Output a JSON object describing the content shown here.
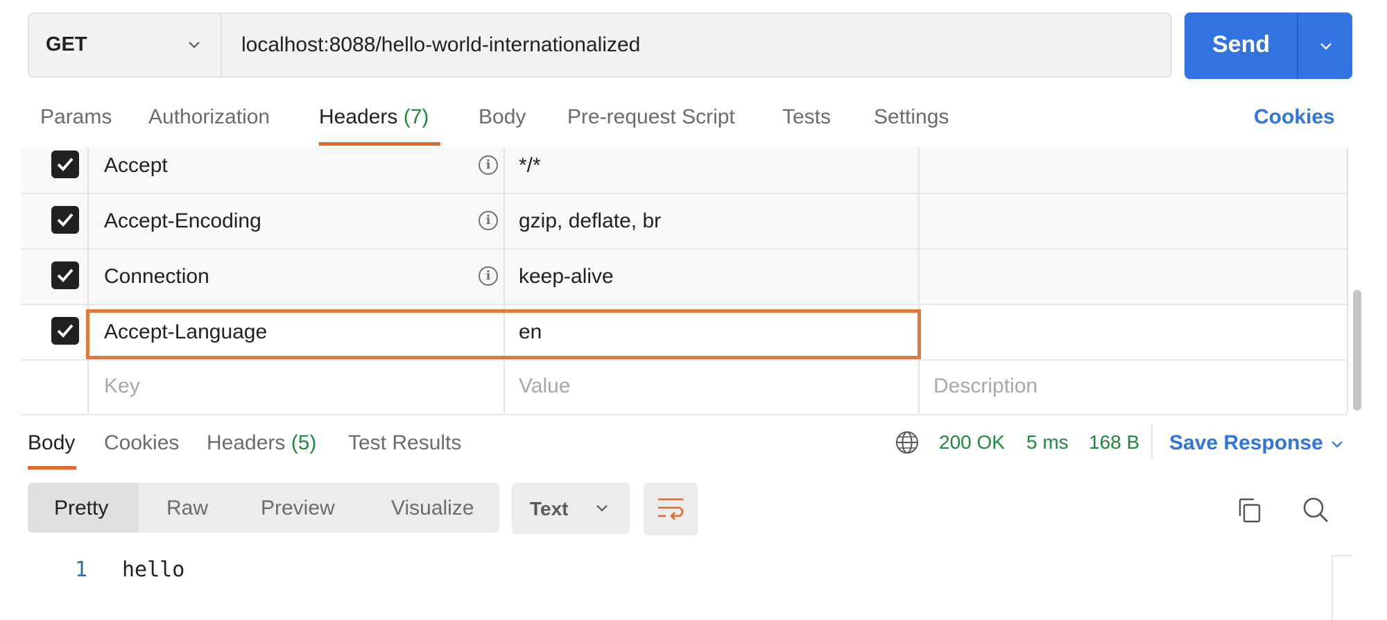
{
  "request": {
    "method": "GET",
    "url": "localhost:8088/hello-world-internationalized",
    "send_label": "Send"
  },
  "request_tabs": {
    "params": "Params",
    "authorization": "Authorization",
    "headers": "Headers",
    "headers_count": "(7)",
    "body": "Body",
    "pre_request": "Pre-request Script",
    "tests": "Tests",
    "settings": "Settings",
    "cookies": "Cookies",
    "active": "Headers"
  },
  "headers_table": {
    "rows": [
      {
        "enabled": true,
        "key": "Accept",
        "value": "*/*",
        "auto": true
      },
      {
        "enabled": true,
        "key": "Accept-Encoding",
        "value": "gzip, deflate, br",
        "auto": true
      },
      {
        "enabled": true,
        "key": "Connection",
        "value": "keep-alive",
        "auto": true
      },
      {
        "enabled": true,
        "key": "Accept-Language",
        "value": "en",
        "auto": false,
        "highlighted": true
      }
    ],
    "placeholders": {
      "key": "Key",
      "value": "Value",
      "description": "Description"
    }
  },
  "response_tabs": {
    "body": "Body",
    "cookies": "Cookies",
    "headers": "Headers",
    "headers_count": "(5)",
    "test_results": "Test Results",
    "active": "Body"
  },
  "response_status": {
    "status": "200 OK",
    "time": "5 ms",
    "size": "168 B",
    "save_label": "Save Response"
  },
  "response_view": {
    "modes": [
      "Pretty",
      "Raw",
      "Preview",
      "Visualize"
    ],
    "active_mode": "Pretty",
    "format": "Text"
  },
  "response_body": {
    "lines": [
      {
        "number": "1",
        "text": "hello"
      }
    ]
  },
  "colors": {
    "accent_blue": "#2f74e0",
    "accent_orange": "#e0682c",
    "status_green": "#1e8a3c",
    "highlight_orange": "#e07a3a"
  },
  "icons": [
    "chevron-down-icon",
    "info-icon",
    "checkmark-icon",
    "globe-icon",
    "wrap-lines-icon",
    "copy-icon",
    "search-icon"
  ]
}
